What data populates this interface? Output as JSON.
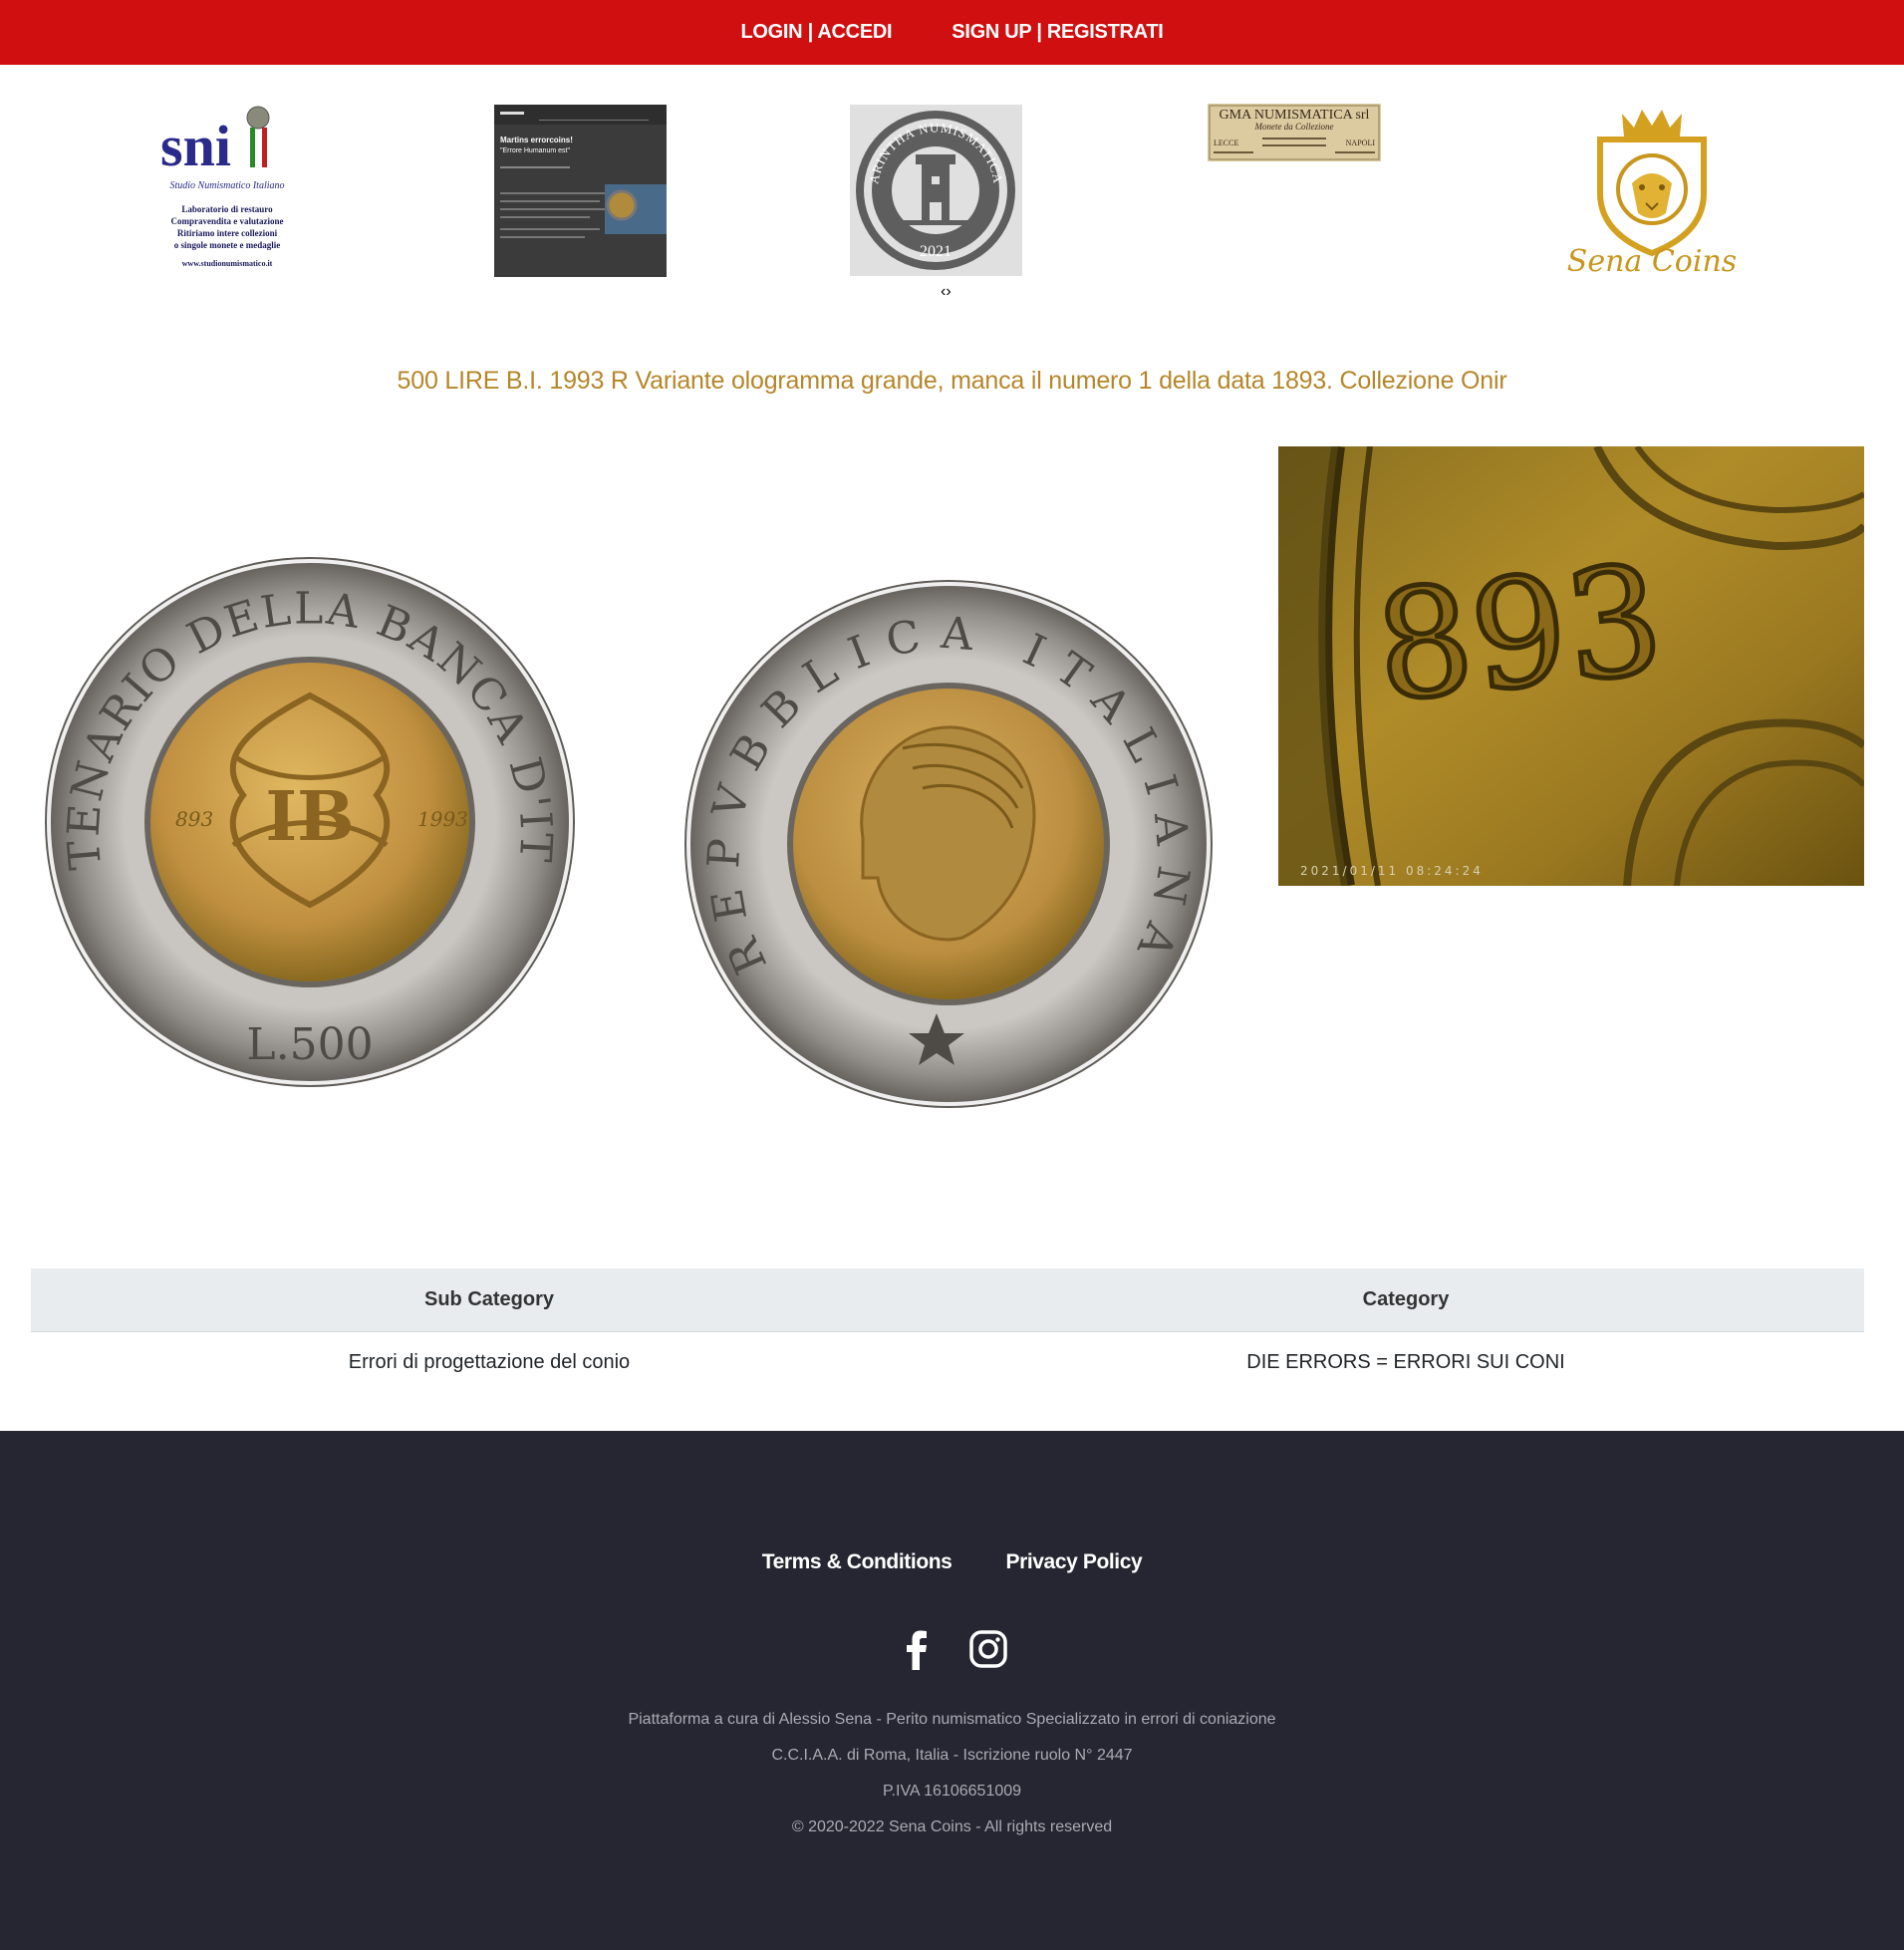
{
  "topbar": {
    "login_label": "LOGIN | ACCEDI",
    "signup_label": "SIGN UP | REGISTRATI",
    "color": "#d01010"
  },
  "sponsors": {
    "sni": {
      "brand": "sni",
      "name": "Studio Numismatico Italiano",
      "lines": [
        "Laboratorio di restauro",
        "Compravendita e valutazione",
        "Ritiriamo intere collezioni",
        "o singole monete e medaglie"
      ],
      "url": "www.studionumismatico.it"
    },
    "martins": {
      "title": "Martins errorcoins!",
      "subtitle": "\"Errore Humanum est\""
    },
    "arintha": {
      "name": "ARINTHA NUMISMATICA",
      "year": "2021"
    },
    "gma": {
      "name": "GMA NUMISMATICA srl",
      "tagline": "Monete da Collezione",
      "city_left": "LECCE",
      "city_right": "NAPOLI"
    },
    "sena": {
      "name": "Sena Coins"
    },
    "arrows": "‹›"
  },
  "coin": {
    "title": "500 LIRE B.I. 1993 R Variante ologramma grande, manca il numero 1 della data 1893. Collezione Onir",
    "obverse": {
      "legend": "CENTENARIO DELLA BANCA D'ITALIA",
      "value": "L.500",
      "date_left": "893",
      "date_right": "1993"
    },
    "reverse": {
      "legend": "REPVBBLICA ITALIANA"
    },
    "closeup": {
      "digits": "893",
      "stamp": "2021/01/11 08:24:24"
    }
  },
  "table": {
    "headers": [
      "Sub Category",
      "Category"
    ],
    "row": [
      "Errori di progettazione del conio",
      "DIE ERRORS = ERRORI SUI CONI"
    ]
  },
  "footer": {
    "terms_label": "Terms & Conditions",
    "privacy_label": "Privacy Policy",
    "social_icons": [
      "facebook-icon",
      "instagram-icon"
    ],
    "lines": [
      "Piattaforma a cura di Alessio Sena - Perito numismatico Specializzato in errori di coniazione",
      "C.C.I.A.A. di Roma, Italia - Iscrizione ruolo N° 2447",
      "P.IVA 16106651009",
      "© 2020-2022 Sena Coins - All rights reserved"
    ],
    "bg": "#252631"
  },
  "accent": "#b5862a"
}
